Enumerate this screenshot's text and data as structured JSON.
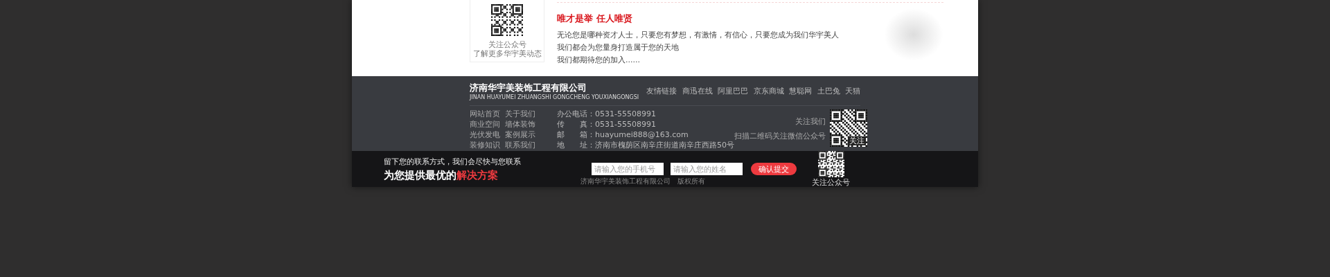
{
  "recruit": {
    "qr_caption": [
      "关注公众号",
      "了解更多华宇美动态"
    ],
    "title": "唯才是举 任人唯贤",
    "paragraphs": [
      "无论您是哪种资才人士，只要您有梦想，有激情，有信心，只要您成为我们华宇美人",
      "我们都会为您量身打造属于您的天地",
      "我们都期待您的加入......"
    ]
  },
  "footer": {
    "logo": {
      "name": "济南华宇美装饰工程有限公司",
      "pinyin": "JINAN HUAYUMEI ZHUANGSHI GONGCHENG YOUXIANGONGSI"
    },
    "links": [
      "友情链接",
      "商迅在线",
      "阿里巴巴",
      "京东商城",
      "慧聪网",
      "土巴兔",
      "天猫"
    ],
    "nav_columns": [
      [
        "网站首页",
        "商业空间",
        "光伏发电",
        "装修知识"
      ],
      [
        "关于我们",
        "墙体装饰",
        "案例展示",
        "联系我们"
      ]
    ],
    "contacts": [
      {
        "label": "办公电话：",
        "value": "0531-55508991"
      },
      {
        "label": "传　　真：",
        "value": "0531-55508991"
      },
      {
        "label": "邮　　箱：",
        "value": "huayumei888@163.com"
      },
      {
        "label": "地　　址：",
        "value": "济南市槐荫区南辛庄街道南辛庄西路50号"
      }
    ],
    "follow": [
      "关注我们",
      "扫描二维码关注微信公众号"
    ],
    "qr_label": "关注",
    "copyright": "济南华宇美装饰工程有限公司　版权所有"
  },
  "contact_bar": {
    "subtitle": "留下您的联系方式，我们会尽快与您联系",
    "headline": [
      {
        "text": "为您提供最优的",
        "highlight": false
      },
      {
        "text": "解决方案",
        "highlight": true
      }
    ],
    "fields": [
      {
        "placeholder": "请输入您的手机号"
      },
      {
        "placeholder": "请输入您的姓名"
      }
    ],
    "button": "确认提交",
    "qr_caption": "关注公众号"
  }
}
